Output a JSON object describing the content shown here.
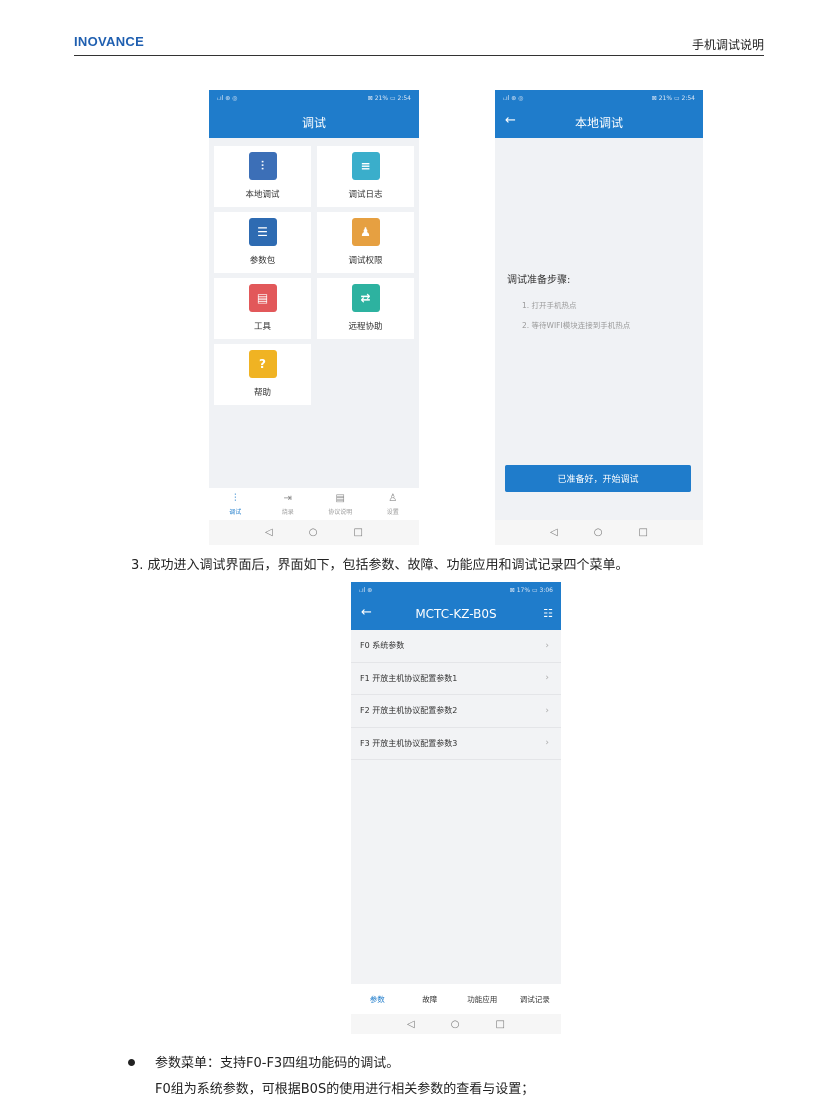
{
  "header": {
    "brand": "INOVANCE",
    "title": "手机调试说明"
  },
  "phone1": {
    "status_left": "ᵢ.ıl ⊛ ◎",
    "status_right": "⊠ 21% ▭ 2:54",
    "title": "调试",
    "tiles": [
      {
        "label": "本地调试",
        "icon": "monitor-sliders-icon",
        "color": "#3c6fb7",
        "glyph": "⫶"
      },
      {
        "label": "调试日志",
        "icon": "log-document-icon",
        "color": "#3aaecb",
        "glyph": "≡"
      },
      {
        "label": "参数包",
        "icon": "parameter-pack-icon",
        "color": "#2e6bb2",
        "glyph": "☰"
      },
      {
        "label": "调试权限",
        "icon": "user-permission-icon",
        "color": "#e6a041",
        "glyph": "♟"
      },
      {
        "label": "工具",
        "icon": "toolbox-icon",
        "color": "#e2585a",
        "glyph": "▤"
      },
      {
        "label": "远程协助",
        "icon": "remote-assist-icon",
        "color": "#2db2a0",
        "glyph": "⇄"
      },
      {
        "label": "帮助",
        "icon": "help-icon",
        "color": "#f0b323",
        "glyph": "?"
      }
    ],
    "nav": [
      {
        "label": "调试",
        "icon": "sliders-icon",
        "glyph": "⫶"
      },
      {
        "label": "烧录",
        "icon": "burn-icon",
        "glyph": "⇥"
      },
      {
        "label": "协议说明",
        "icon": "document-icon",
        "glyph": "▤"
      },
      {
        "label": "设置",
        "icon": "person-settings-icon",
        "glyph": "♙"
      }
    ]
  },
  "phone2": {
    "status_left": "ᵢ.ıl ⊛ ◎",
    "status_right": "⊠ 21% ▭ 2:54",
    "title": "本地调试",
    "prep_title": "调试准备步骤:",
    "steps": [
      "1. 打开手机热点",
      "2. 等待WIFI模块连接到手机热点"
    ],
    "button": "已准备好，开始调试"
  },
  "caption": "3. 成功进入调试界面后，界面如下，包括参数、故障、功能应用和调试记录四个菜单。",
  "phone3": {
    "status_left": "ᵢ.ıl ⊛",
    "status_right": "⊠ 17% ▭ 3:06",
    "title": "MCTC-KZ-B0S",
    "rows": [
      "F0  系统参数",
      "F1  开放主机协议配置参数1",
      "F2  开放主机协议配置参数2",
      "F3  开放主机协议配置参数3"
    ],
    "tabs": [
      "参数",
      "故障",
      "功能应用",
      "调试记录"
    ]
  },
  "sysnav": {
    "back": "◁",
    "home": "○",
    "recent": "□"
  },
  "bullets": {
    "line1": "参数菜单：支持F0-F3四组功能码的调试。",
    "line2": "F0组为系统参数，可根据B0S的使用进行相关参数的查看与设置；"
  }
}
